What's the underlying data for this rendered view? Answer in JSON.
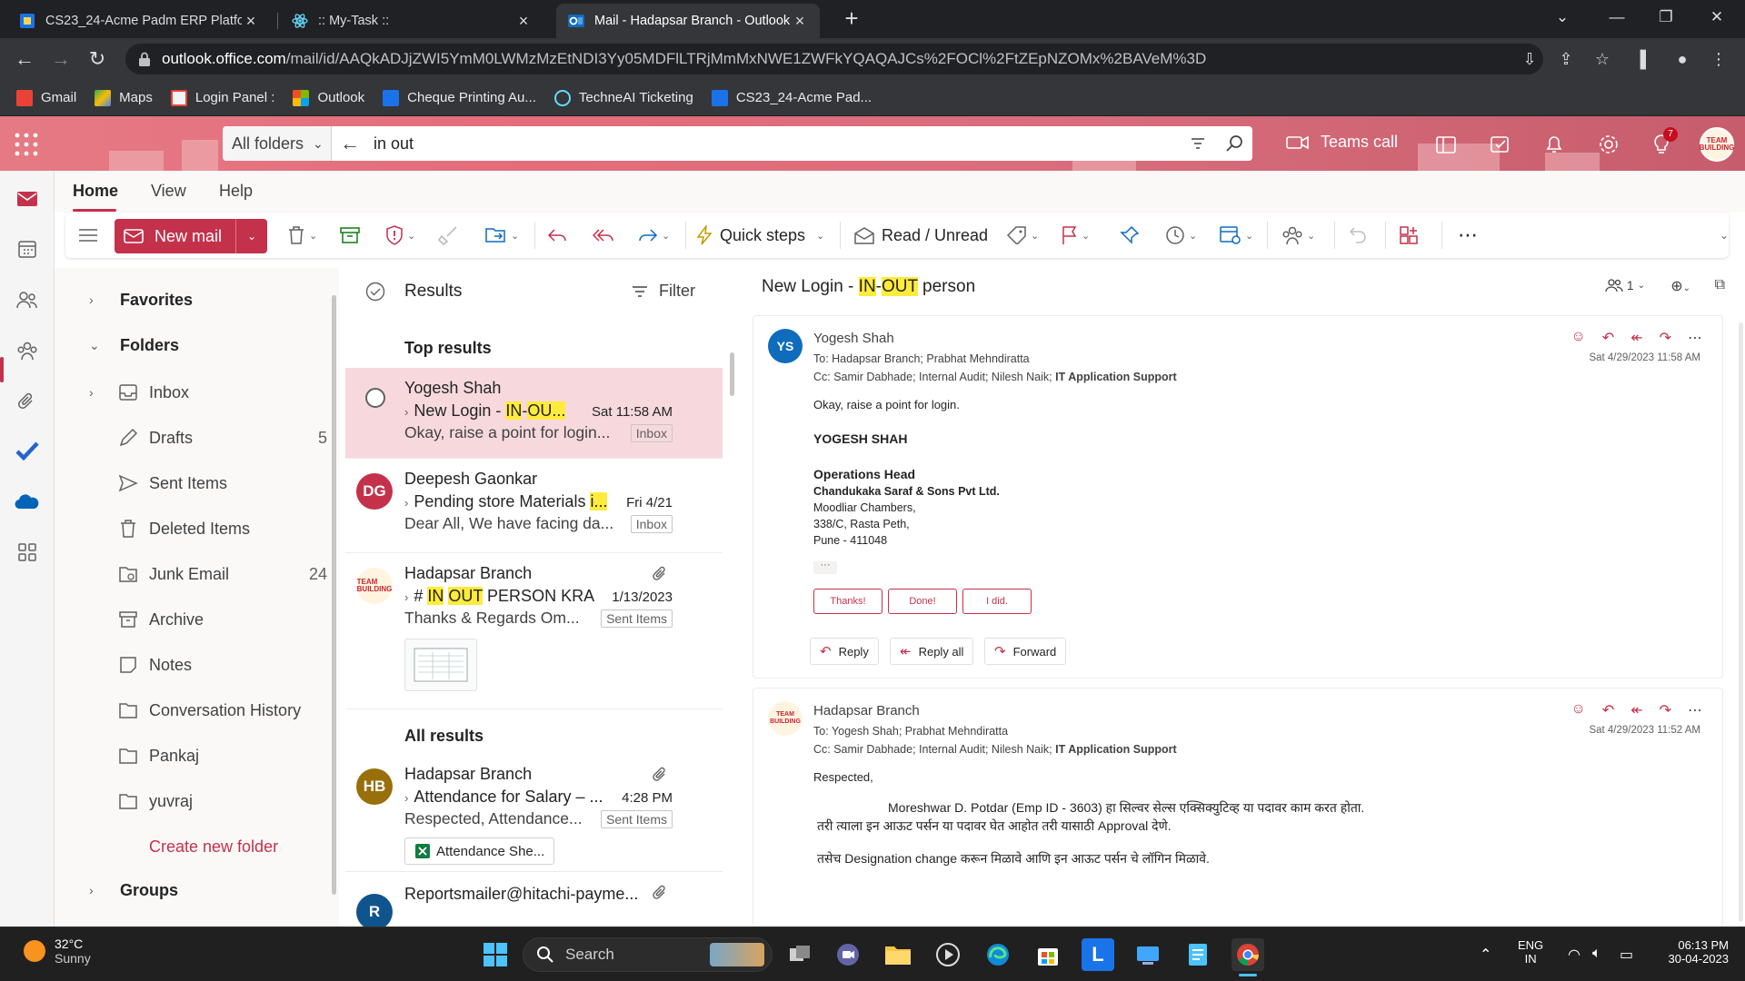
{
  "browser": {
    "tabs": [
      {
        "title": "CS23_24-Acme Padm ERP Platfor",
        "active": false
      },
      {
        "title": ":: My-Task ::",
        "active": false
      },
      {
        "title": "Mail - Hadapsar Branch - Outlook",
        "active": true
      }
    ],
    "url_domain": "outlook.office.com",
    "url_path": "/mail/id/AAQkADJjZWI5YmM0LWMzMzEtNDI3Yy05MDFlLTRjMmMxNWE1ZWFkYQAQAJCs%2FOCl%2FtZEpNZOMx%2BAVeM%3D",
    "bookmarks": [
      "Gmail",
      "Maps",
      "Login Panel :",
      "Outlook",
      "Cheque Printing Au...",
      "TechneAI Ticketing",
      "CS23_24-Acme Pad..."
    ]
  },
  "outlook": {
    "search": {
      "folder": "All folders",
      "query": "in out"
    },
    "teams_call": "Teams call",
    "notification_count": "7",
    "avatar_text": "TEAM BUILDING",
    "ribbon_tabs": [
      "Home",
      "View",
      "Help"
    ],
    "ribbon": {
      "new_mail": "New mail",
      "quick_steps": "Quick steps",
      "read_unread": "Read / Unread"
    },
    "folders": {
      "favorites": "Favorites",
      "folders": "Folders",
      "items": [
        {
          "label": "Inbox",
          "count": "",
          "icon": "inbox-icon"
        },
        {
          "label": "Drafts",
          "count": "5",
          "icon": "drafts-icon"
        },
        {
          "label": "Sent Items",
          "count": "",
          "icon": "send-icon"
        },
        {
          "label": "Deleted Items",
          "count": "",
          "icon": "trash-icon"
        },
        {
          "label": "Junk Email",
          "count": "24",
          "icon": "junk-icon"
        },
        {
          "label": "Archive",
          "count": "",
          "icon": "archive-icon"
        },
        {
          "label": "Notes",
          "count": "",
          "icon": "notes-icon"
        },
        {
          "label": "Conversation History",
          "count": "",
          "icon": "folder-icon"
        },
        {
          "label": "Pankaj",
          "count": "",
          "icon": "folder-icon"
        },
        {
          "label": "yuvraj",
          "count": "",
          "icon": "folder-icon"
        }
      ],
      "create_new": "Create new folder",
      "groups": "Groups"
    },
    "list": {
      "header": "Results",
      "filter": "Filter",
      "top_results": "Top results",
      "all_results": "All results",
      "messages": [
        {
          "initials": "",
          "from": "Yogesh Shah",
          "subject_pre": "New Login - ",
          "hl1": "IN",
          "mid": "-",
          "hl2": "OU...",
          "subject_post": "",
          "date": "Sat 11:58 AM",
          "preview": "Okay, raise a point for login...",
          "tag": "Inbox"
        },
        {
          "initials": "DG",
          "from": "Deepesh Gaonkar",
          "subject_pre": "Pending store Materials ",
          "hl1": "i...",
          "mid": "",
          "hl2": "",
          "subject_post": "",
          "date": "Fri 4/21",
          "preview": "Dear All, We have facing da...",
          "tag": "Inbox"
        },
        {
          "initials": "",
          "from": "Hadapsar Branch",
          "subject_pre": "# ",
          "hl1": "IN",
          "mid": " ",
          "hl2": "OUT",
          "subject_post": " PERSON KRA",
          "date": "1/13/2023",
          "preview": "Thanks & Regards Om...",
          "tag": "Sent Items"
        },
        {
          "initials": "HB",
          "from": "Hadapsar Branch",
          "subject_pre": "Attendance for Salary – ...",
          "hl1": "",
          "mid": "",
          "hl2": "",
          "subject_post": "",
          "date": "4:28 PM",
          "preview": "Respected, Attendance...",
          "tag": "Sent Items",
          "attachment": "Attendance She..."
        },
        {
          "initials": "R",
          "from": "Reportsmailer@hitachi-payme...",
          "subject_pre": "",
          "hl1": "",
          "mid": "",
          "hl2": "",
          "subject_post": "",
          "date": "",
          "preview": "",
          "tag": ""
        }
      ]
    },
    "reading": {
      "subject_pre": "New Login - ",
      "subject_hl1": "IN",
      "subject_mid": "-",
      "subject_hl2": "OUT",
      "subject_post": " person",
      "participants": "1",
      "msg1": {
        "initials": "YS",
        "from": "Yogesh Shah",
        "to": "To:  Hadapsar Branch;  Prabhat Mehndiratta",
        "cc": "Cc:  Samir Dabhade;  Internal Audit;  Nilesh Naik;",
        "cc_bold": "IT Application Support",
        "time": "Sat 4/29/2023 11:58 AM",
        "line1": "Okay, raise a point for login.",
        "name": "YOGESH SHAH",
        "title": "Operations Head",
        "company": "Chandukaka Saraf & Sons Pvt Ltd.",
        "addr1": "Moodliar Chambers,",
        "addr2": "338/C, Rasta Peth,",
        "addr3": "Pune - 411048",
        "quick_replies": [
          "Thanks!",
          "Done!",
          "I did."
        ],
        "reply": "Reply",
        "reply_all": "Reply all",
        "forward": "Forward"
      },
      "msg2": {
        "from": "Hadapsar Branch",
        "to": "To:  Yogesh Shah;  Prabhat Mehndiratta",
        "cc": "Cc:  Samir Dabhade;  Internal Audit;  Nilesh Naik;",
        "cc_bold": "IT Application Support",
        "time": "Sat 4/29/2023 11:52 AM",
        "greeting": "Respected,",
        "line1": "Moreshwar D. Potdar (Emp ID - 3603) हा सिल्वर सेल्स एक्सिक्युटिव्ह या पदावर काम करत होता.",
        "line2": "तरी त्याला इन आऊट पर्सन या पदावर घेत आहोत तरी यासाठी Approval देणे.",
        "line3": "तसेच  Designation change करून मिळावे आणि इन आऊट पर्सन चे लॉगिन मिळावे."
      }
    }
  },
  "taskbar": {
    "temp": "32°C",
    "weather": "Sunny",
    "search": "Search",
    "lang1": "ENG",
    "lang2": "IN",
    "time": "06:13 PM",
    "date": "30-04-2023"
  }
}
